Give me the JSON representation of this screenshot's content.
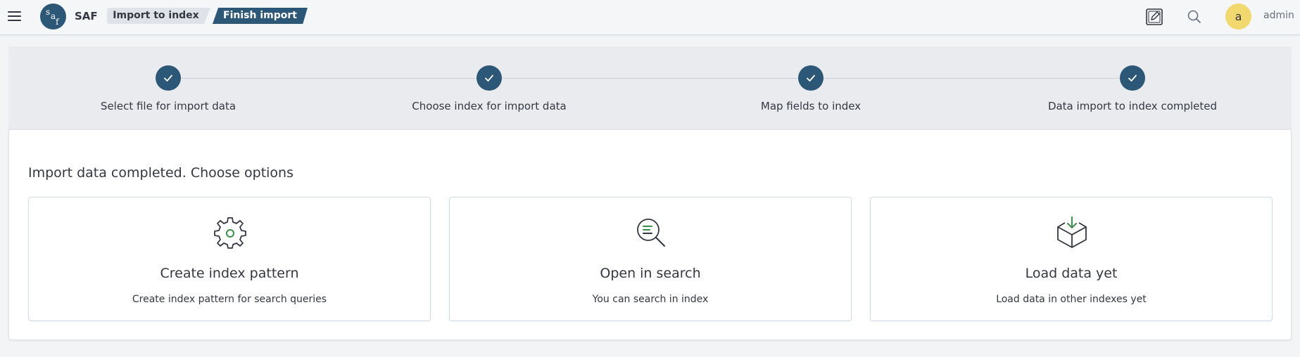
{
  "header": {
    "brand": "SAF",
    "logo_icon": "saf-logo-icon",
    "breadcrumbs": [
      {
        "label": "Import to index"
      },
      {
        "label": "Finish import"
      }
    ],
    "avatar_letter": "a",
    "username": "admin",
    "avatar_color": "#f1d86f"
  },
  "steps": [
    {
      "label": "Select file for import data",
      "done": true
    },
    {
      "label": "Choose index for import data",
      "done": true
    },
    {
      "label": "Map fields to index",
      "done": true
    },
    {
      "label": "Data import to index completed",
      "done": true
    }
  ],
  "main": {
    "title": "Import data completed. Choose options",
    "cards": [
      {
        "icon": "gear-icon",
        "title": "Create index pattern",
        "description": "Create index pattern for search queries"
      },
      {
        "icon": "search-list-icon",
        "title": "Open in search",
        "description": "You can search in index"
      },
      {
        "icon": "box-download-icon",
        "title": "Load data yet",
        "description": "Load data in other indexes yet"
      }
    ]
  },
  "colors": {
    "accent": "#2d5777",
    "icon_green": "#3a8f4b"
  }
}
